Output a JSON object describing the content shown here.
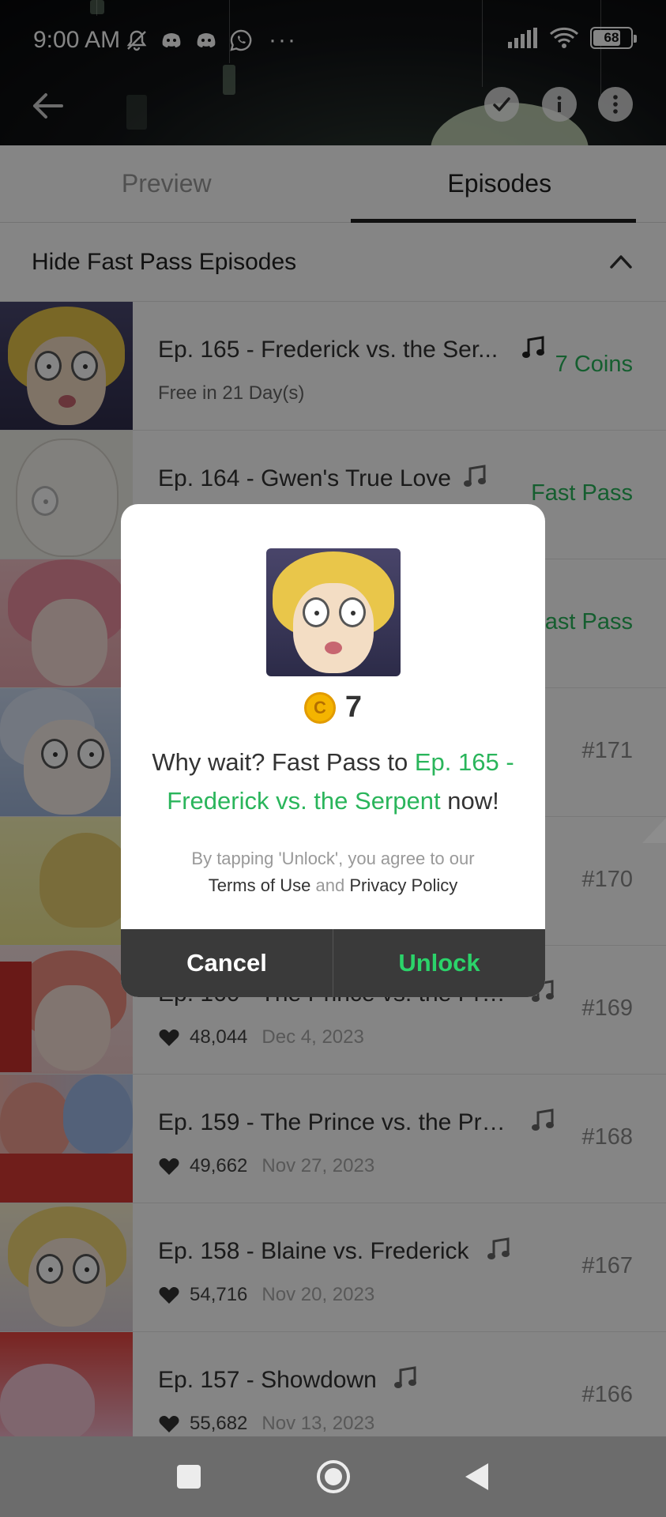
{
  "status_bar": {
    "time": "9:00 AM",
    "more": "···",
    "battery_level": "68",
    "icons": [
      "mute-icon",
      "discord-icon",
      "discord-icon",
      "whatsapp-icon",
      "signal-icon",
      "wifi-icon",
      "battery-icon"
    ]
  },
  "header": {
    "icons": [
      "back-arrow-icon",
      "check-icon",
      "info-icon",
      "more-vert-icon"
    ]
  },
  "tabs": [
    {
      "label": "Preview",
      "active": false
    },
    {
      "label": "Episodes",
      "active": true
    }
  ],
  "fast_pass_toggle": {
    "label": "Hide Fast Pass Episodes"
  },
  "episodes": [
    {
      "title": "Ep. 165 - Frederick vs. the Ser...",
      "subtitle": "Free in 21 Day(s)",
      "right": "7 Coins"
    },
    {
      "title": "Ep. 164 - Gwen's True Love",
      "right": "Fast Pass"
    },
    {
      "title": "",
      "right": "Fast Pass"
    },
    {
      "title": "",
      "right": "#171"
    },
    {
      "title": "",
      "right": "#170"
    },
    {
      "title": "Ep. 160 - The Prince vs. the Pre...",
      "likes": "48,044",
      "date": "Dec 4, 2023",
      "right": "#169"
    },
    {
      "title": "Ep. 159 - The Prince vs. the Pre...",
      "likes": "49,662",
      "date": "Nov 27, 2023",
      "right": "#168"
    },
    {
      "title": "Ep. 158 - Blaine vs. Frederick",
      "likes": "54,716",
      "date": "Nov 20, 2023",
      "right": "#167"
    },
    {
      "title": "Ep. 157 - Showdown",
      "likes": "55,682",
      "date": "Nov 13, 2023",
      "right": "#166"
    }
  ],
  "dialog": {
    "coin_symbol": "C",
    "coin_count": "7",
    "message_prefix": "Why wait? Fast Pass to ",
    "episode_link": "Ep. 165 - Frederick vs. the Serpent",
    "message_suffix": " now!",
    "terms_prefix": "By tapping 'Unlock', you agree to our",
    "terms_of_use": "Terms of Use",
    "terms_and": "and",
    "privacy_policy": "Privacy Policy",
    "cancel_label": "Cancel",
    "unlock_label": "Unlock"
  },
  "colors": {
    "accent_green": "#2ab55b",
    "unlock_green": "#2bd36a",
    "dialog_button_bar": "#3a3a3a",
    "coin_gold": "#f4b400"
  },
  "nav_bar": {
    "icons": [
      "recents-icon",
      "home-icon",
      "back-icon"
    ]
  }
}
